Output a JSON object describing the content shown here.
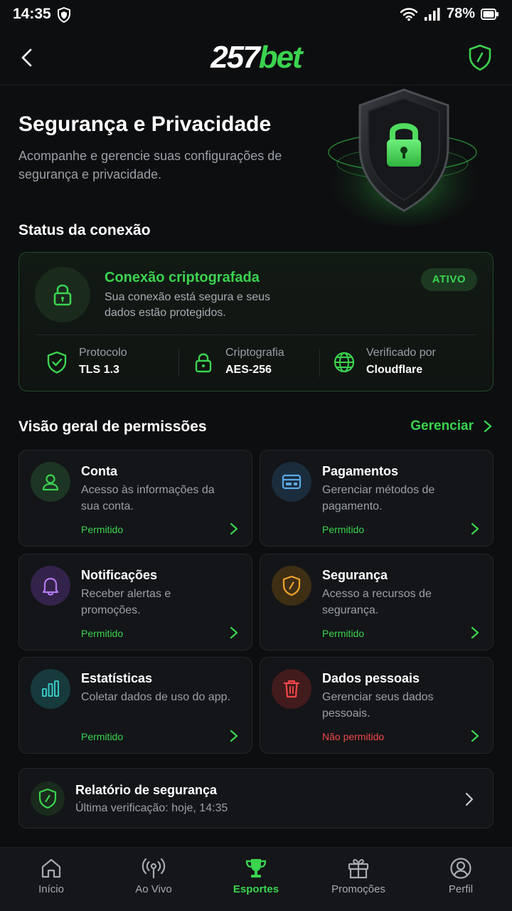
{
  "status_bar": {
    "time": "14:35",
    "battery": "78%"
  },
  "header": {
    "logo_part1": "257",
    "logo_part2": "bet"
  },
  "hero": {
    "title": "Segurança e Privacidade",
    "subtitle": "Acompanhe e gerencie suas configurações de segurança e privacidade."
  },
  "connection": {
    "section_title": "Status da conexão",
    "title": "Conexão criptografada",
    "description": "Sua conexão está segura e seus dados estão protegidos.",
    "badge": "ATIVO",
    "meta": [
      {
        "label": "Protocolo",
        "value": "TLS 1.3"
      },
      {
        "label": "Criptografia",
        "value": "AES-256"
      },
      {
        "label": "Verificado por",
        "value": "Cloudflare"
      }
    ]
  },
  "permissions": {
    "section_title": "Visão geral de permissões",
    "manage_label": "Gerenciar",
    "items": [
      {
        "title": "Conta",
        "description": "Acesso às informações da sua conta.",
        "status": "Permitido",
        "icon": "user-icon"
      },
      {
        "title": "Pagamentos",
        "description": "Gerenciar métodos de pagamento.",
        "status": "Permitido",
        "icon": "card-icon"
      },
      {
        "title": "Notificações",
        "description": "Receber alertas e promoções.",
        "status": "Permitido",
        "icon": "bell-icon"
      },
      {
        "title": "Segurança",
        "description": "Acesso a recursos de segurança.",
        "status": "Permitido",
        "icon": "shield-icon"
      },
      {
        "title": "Estatísticas",
        "description": "Coletar dados de uso do app.",
        "status": "Permitido",
        "icon": "bar-chart-icon"
      },
      {
        "title": "Dados pessoais",
        "description": "Gerenciar seus dados pessoais.",
        "status": "Não permitido",
        "icon": "trash-icon"
      }
    ]
  },
  "report": {
    "title": "Relatório de segurança",
    "subtitle": "Última verificação: hoje, 14:35"
  },
  "nav": {
    "items": [
      {
        "label": "Início",
        "icon": "home-icon"
      },
      {
        "label": "Ao Vivo",
        "icon": "live-icon"
      },
      {
        "label": "Esportes",
        "icon": "trophy-icon",
        "active": true
      },
      {
        "label": "Promoções",
        "icon": "gift-icon"
      },
      {
        "label": "Perfil",
        "icon": "profile-icon"
      }
    ]
  },
  "colors": {
    "accent": "#3bd34f",
    "danger": "#f04848",
    "background": "#0d0e10",
    "card": "#131518"
  }
}
